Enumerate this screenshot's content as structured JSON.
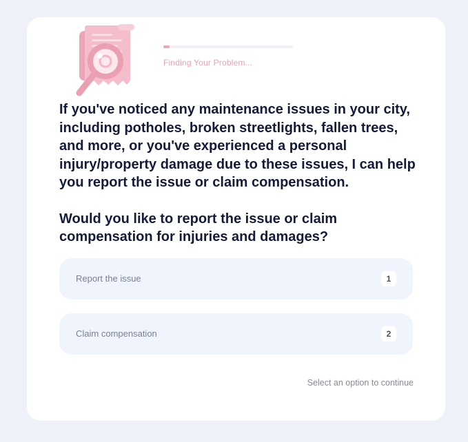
{
  "progress": {
    "label": "Finding Your Problem...",
    "fraction": 0.05,
    "fill_color": "#e8a6bc"
  },
  "illustration": {
    "icon": "document-magnifier-icon",
    "color": "#f3b6c7"
  },
  "question": {
    "intro": "If you've noticed any maintenance issues in your city, including potholes, broken streetlights, fallen trees, and more, or you've experienced a personal injury/property damage due to these issues, I can help you report the issue or claim compensation.",
    "prompt": "Would you like to report the issue or claim compensation for injuries and damages?"
  },
  "options": [
    {
      "label": "Report the issue",
      "key": "1"
    },
    {
      "label": "Claim compensation",
      "key": "2"
    }
  ],
  "hint": "Select an option to continue"
}
